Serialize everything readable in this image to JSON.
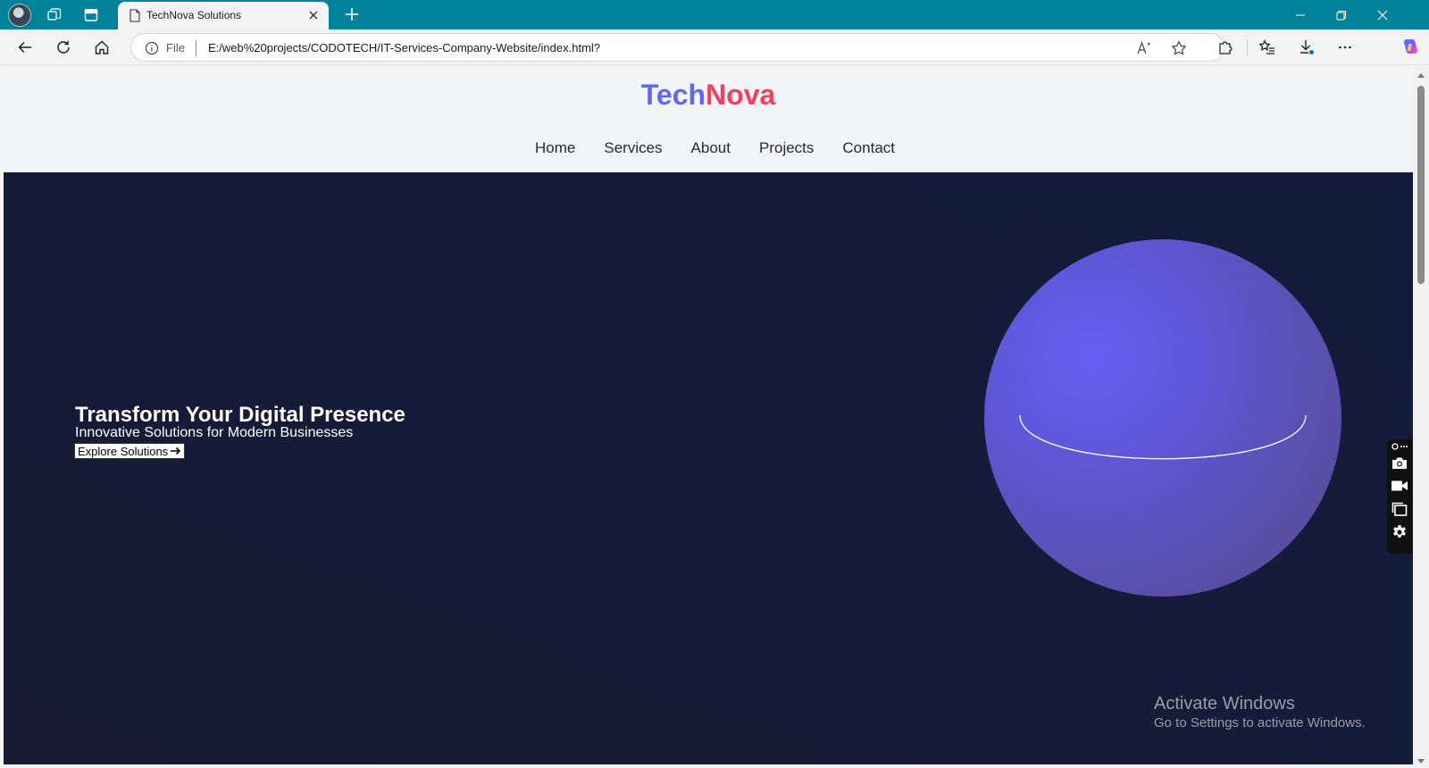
{
  "browser": {
    "tab": {
      "title": "TechNova Solutions"
    },
    "address_bar": {
      "file_label": "File",
      "url": "E:/web%20projects/CODOTECH/IT-Services-Company-Website/index.html?"
    },
    "icons": {
      "back": "back-arrow-icon",
      "refresh": "refresh-icon",
      "home": "home-icon",
      "read_aloud": "read-aloud-icon",
      "favorite": "star-icon",
      "extensions": "puzzle-icon",
      "favorites": "favorites-list-icon",
      "downloads": "download-icon",
      "more": "ellipsis-icon",
      "copilot": "copilot-icon"
    }
  },
  "site": {
    "logo": {
      "part1": "Tech",
      "part2": "Nova"
    },
    "nav": [
      "Home",
      "Services",
      "About",
      "Projects",
      "Contact"
    ],
    "hero": {
      "title": "Transform Your Digital Presence",
      "subtitle": "Innovative Solutions for Modern Businesses",
      "button_label": "Explore Solutions",
      "button_icon": "arrow-right-icon"
    },
    "colors": {
      "logo_primary": "#6366f1",
      "logo_accent": "#f43f5e",
      "hero_bg": "#141c3a",
      "sphere": "#6461f5",
      "tab_bar": "#00829b"
    }
  },
  "overlay": {
    "side_tools": [
      "pin-icon",
      "camera-icon",
      "video-icon",
      "window-icon",
      "gear-icon"
    ]
  },
  "watermark": {
    "title": "Activate Windows",
    "subtitle": "Go to Settings to activate Windows."
  }
}
